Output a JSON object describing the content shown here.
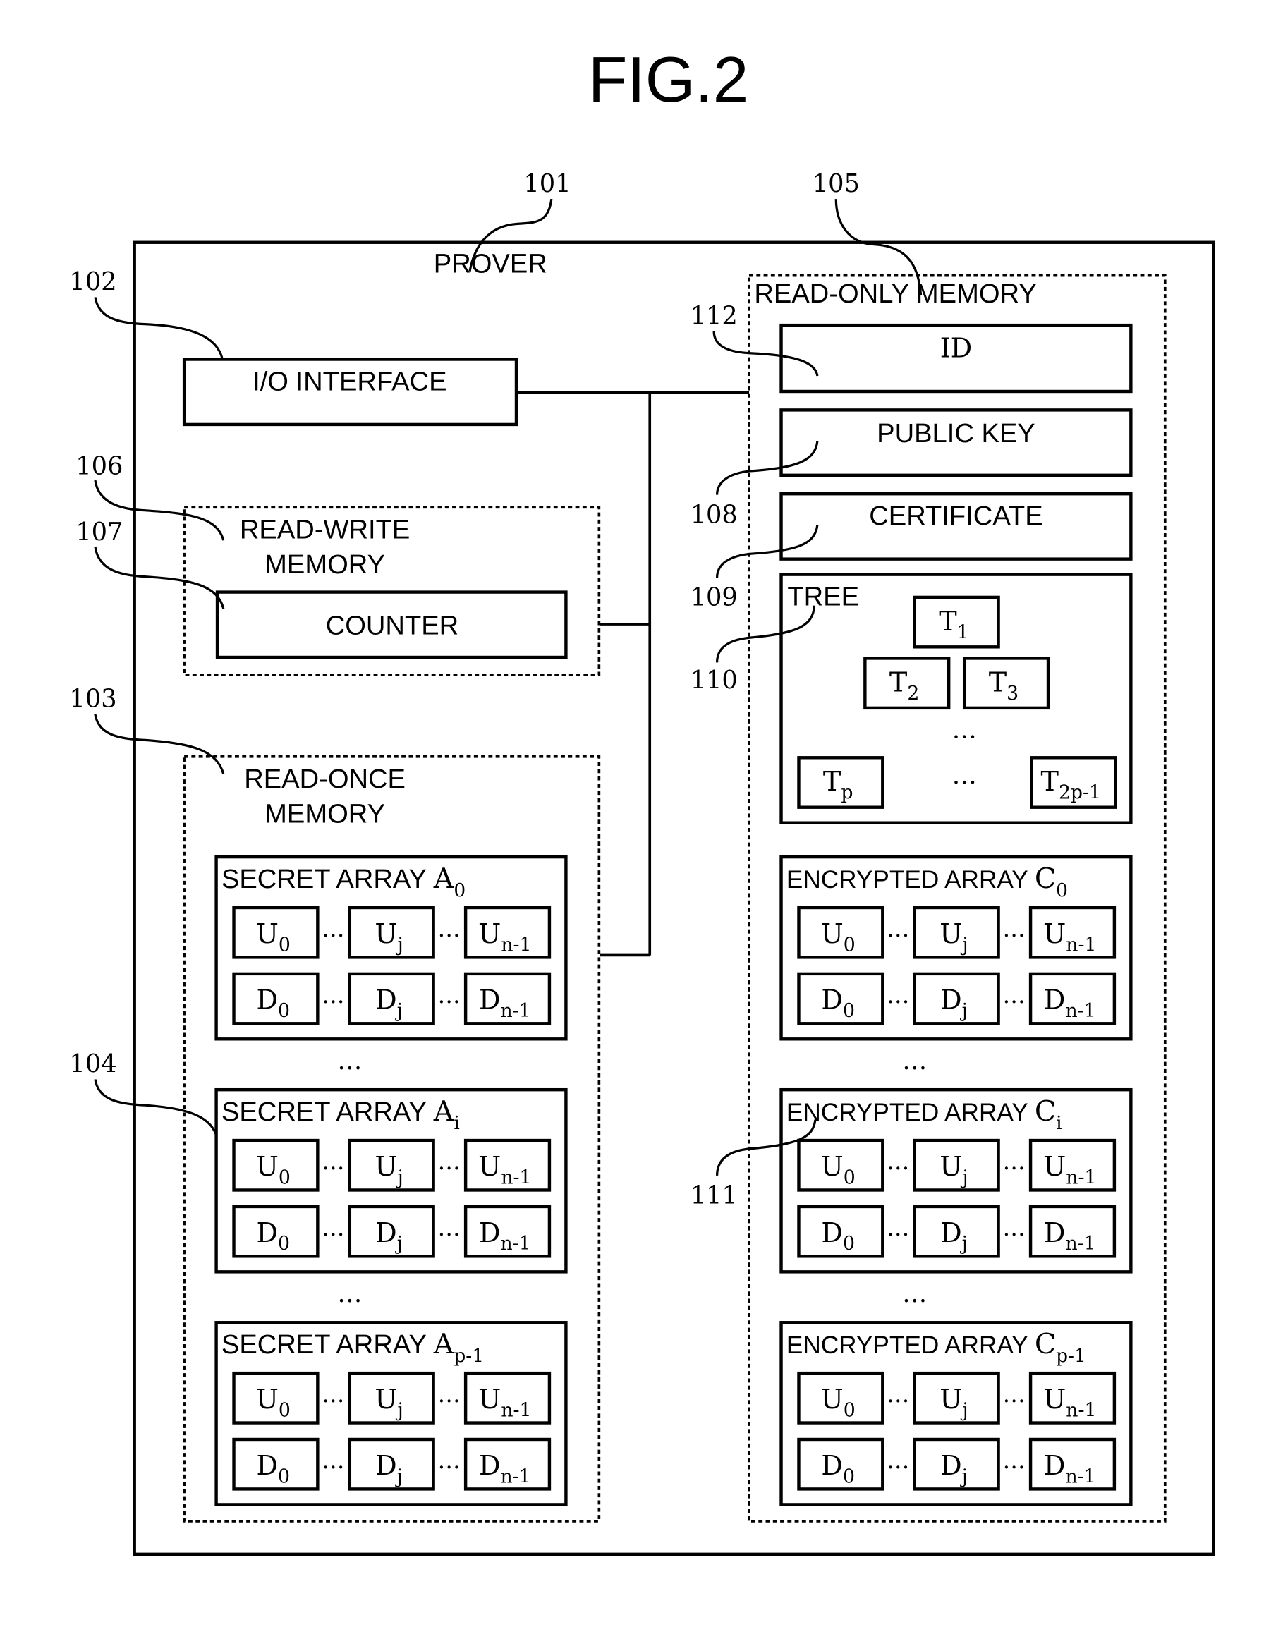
{
  "figure": {
    "title": "FIG.2",
    "prover": {
      "label": "PROVER",
      "ref": "101"
    },
    "io_interface": {
      "label": "I/O INTERFACE",
      "ref": "102"
    },
    "read_write_memory": {
      "label_line1": "READ-WRITE",
      "label_line2": "MEMORY",
      "ref": "106",
      "counter": {
        "label": "COUNTER",
        "ref": "107"
      }
    },
    "read_once_memory": {
      "label_line1": "READ-ONCE",
      "label_line2": "MEMORY",
      "ref": "103",
      "array_ref": "104",
      "ellipsis": "…",
      "arrays": [
        {
          "title": "SECRET ARRAY A",
          "sub": "0"
        },
        {
          "title": "SECRET ARRAY A",
          "sub": "i"
        },
        {
          "title": "SECRET ARRAY A",
          "sub": "p-1"
        }
      ]
    },
    "read_only_memory": {
      "label": "READ-ONLY MEMORY",
      "ref": "105",
      "id": {
        "label": "ID",
        "ref": "112"
      },
      "public_key": {
        "label": "PUBLIC KEY",
        "ref": "108"
      },
      "certificate": {
        "label": "CERTIFICATE",
        "ref": "109"
      },
      "tree": {
        "label": "TREE",
        "ref": "110",
        "ellipsis": "…",
        "nodes": [
          {
            "base": "T",
            "sub": "1"
          },
          {
            "base": "T",
            "sub": "2"
          },
          {
            "base": "T",
            "sub": "3"
          },
          {
            "base": "T",
            "sub": "p"
          },
          {
            "base": "T",
            "sub": "2p-1"
          }
        ]
      },
      "array_ref": "111",
      "ellipsis": "…",
      "arrays": [
        {
          "title": "ENCRYPTED ARRAY C",
          "sub": "0"
        },
        {
          "title": "ENCRYPTED ARRAY C",
          "sub": "i"
        },
        {
          "title": "ENCRYPTED ARRAY C",
          "sub": "p-1"
        }
      ]
    },
    "cells": {
      "ellipsis": "…",
      "u_row": [
        {
          "base": "U",
          "sub": "0"
        },
        {
          "base": "U",
          "sub": "j"
        },
        {
          "base": "U",
          "sub": "n-1"
        }
      ],
      "d_row": [
        {
          "base": "D",
          "sub": "0"
        },
        {
          "base": "D",
          "sub": "j"
        },
        {
          "base": "D",
          "sub": "n-1"
        }
      ]
    }
  }
}
